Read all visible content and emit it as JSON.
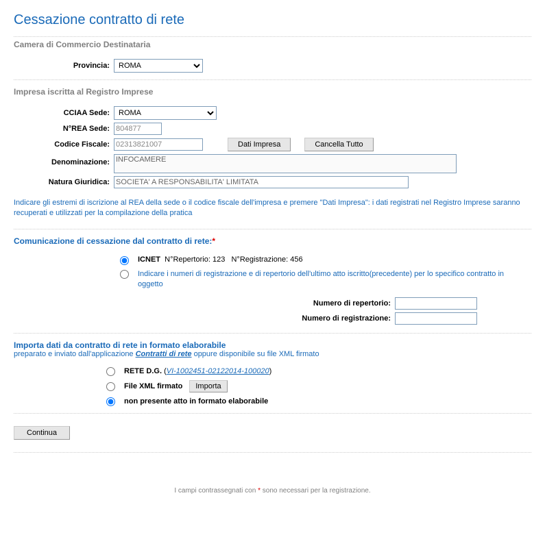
{
  "page_title": "Cessazione contratto di rete",
  "camera": {
    "section": "Camera di Commercio Destinataria",
    "provincia_label": "Provincia:",
    "provincia_value": "ROMA"
  },
  "impresa": {
    "section": "Impresa iscritta al Registro Imprese",
    "cciaa_label": "CCIAA Sede:",
    "cciaa_value": "ROMA",
    "nrea_label": "N°REA Sede:",
    "nrea_value": "804877",
    "cf_label": "Codice Fiscale:",
    "cf_value": "02313821007",
    "dati_impresa_btn": "Dati Impresa",
    "cancella_btn": "Cancella Tutto",
    "denom_label": "Denominazione:",
    "denom_value": "INFOCAMERE",
    "natura_label": "Natura Giuridica:",
    "natura_value": "SOCIETA' A RESPONSABILITA' LIMITATA",
    "info_text": "Indicare gli estremi di iscrizione al REA della sede o il codice fiscale dell'impresa e premere \"Dati Impresa\": i dati registrati nel Registro Imprese saranno recuperati e utilizzati per la compilazione della pratica"
  },
  "cessazione": {
    "title": "Comunicazione di cessazione dal contratto di rete:",
    "opt1_name": "ICNET",
    "opt1_rep_label": "N°Repertorio:",
    "opt1_rep_value": "123",
    "opt1_reg_label": "N°Registrazione:",
    "opt1_reg_value": "456",
    "opt2_text": "Indicare i numeri di registrazione e di repertorio dell'ultimo atto iscritto(precedente) per lo specifico contratto in oggetto",
    "num_rep_label": "Numero di repertorio:",
    "num_rep_value": "",
    "num_reg_label": "Numero di registrazione:",
    "num_reg_value": ""
  },
  "importa": {
    "title": "Importa dati da contratto di rete in formato elaborabile",
    "sub_prefix": "preparato e inviato dall'applicazione ",
    "sub_link": "Contratti di rete",
    "sub_suffix": " oppure disponibile su file XML firmato",
    "opt1_label": "RETE D.G.",
    "opt1_file": "VI-1002451-02122014-100020",
    "opt2_label": "File XML firmato",
    "opt2_btn": "Importa",
    "opt3_label": "non presente atto in formato elaborabile"
  },
  "continue_btn": "Continua",
  "footer": {
    "prefix": "I campi contrassegnati con ",
    "suffix": " sono necessari per la registrazione."
  }
}
